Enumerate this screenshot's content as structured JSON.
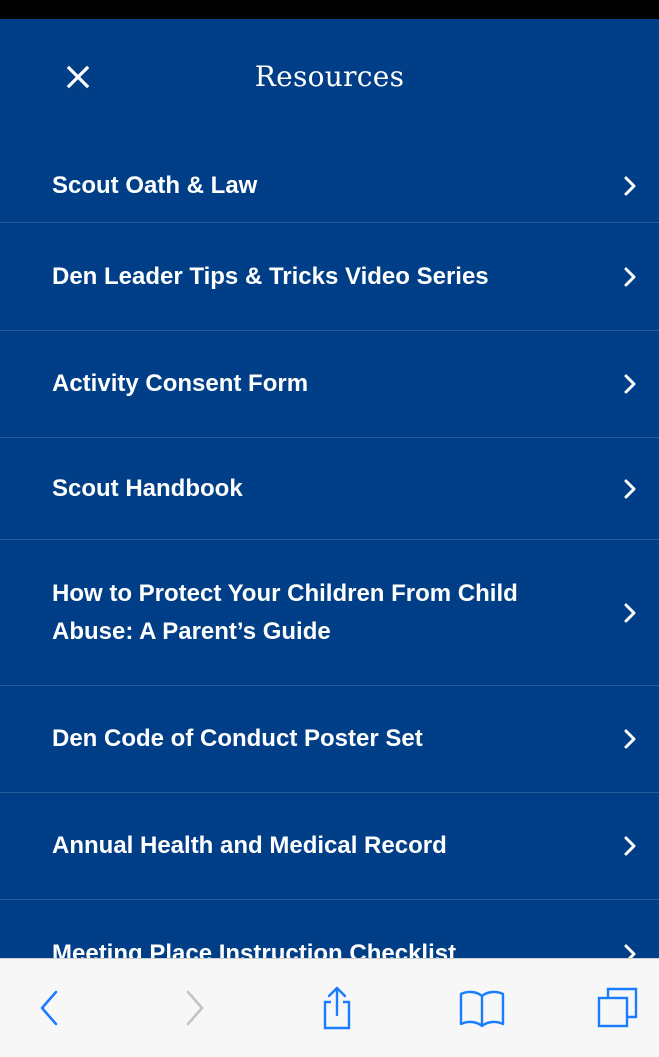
{
  "header": {
    "title": "Resources"
  },
  "items": [
    {
      "label": "Scout Oath & Law"
    },
    {
      "label": "Den Leader Tips & Tricks Video Series"
    },
    {
      "label": "Activity Consent Form"
    },
    {
      "label": "Scout Handbook"
    },
    {
      "label": "How to Protect Your Children From Child Abuse: A Parent’s Guide"
    },
    {
      "label": "Den Code of Conduct Poster Set"
    },
    {
      "label": "Annual Health and Medical Record"
    },
    {
      "label": "Meeting Place Instruction Checklist"
    }
  ],
  "toolbar": {
    "icons": [
      "back-icon",
      "forward-icon",
      "share-icon",
      "bookmarks-icon",
      "tabs-icon"
    ]
  },
  "colors": {
    "background": "#003f87",
    "text": "#ffffff",
    "toolbar_bg": "#f7f7f7",
    "toolbar_icon": "#1a7cff"
  }
}
